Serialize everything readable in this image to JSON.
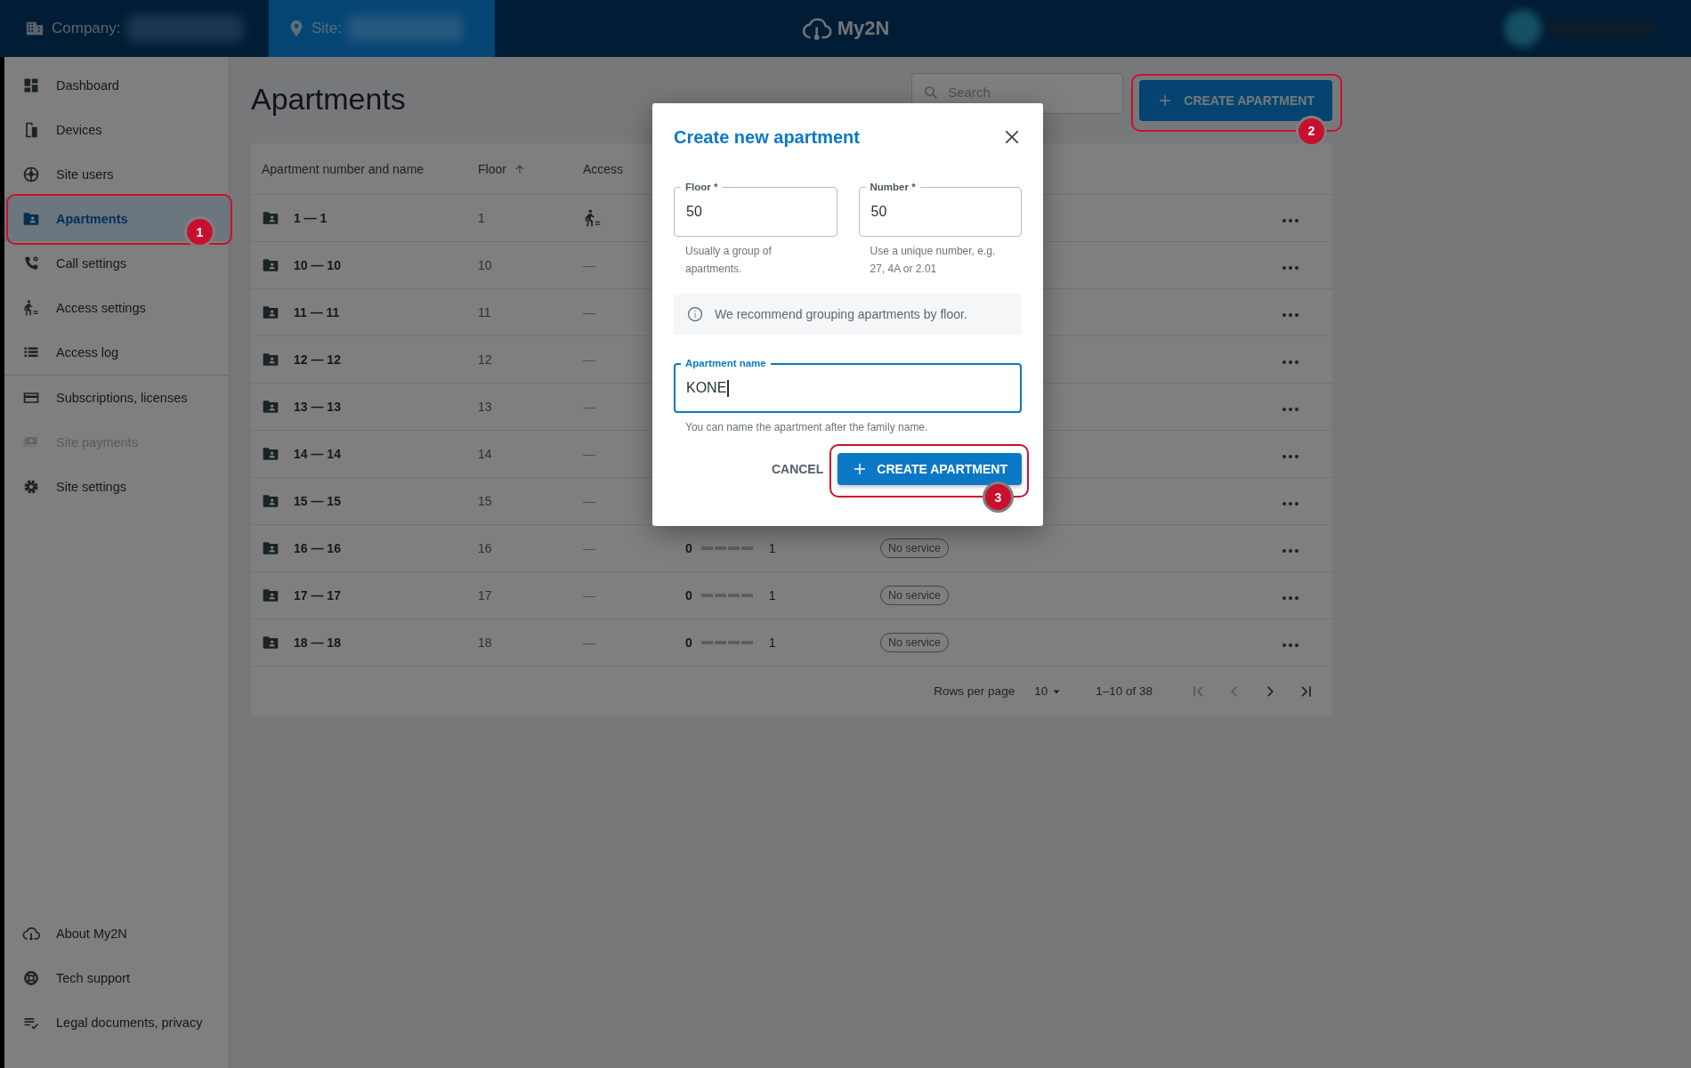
{
  "topbar": {
    "company_label": "Company:",
    "site_label": "Site:",
    "logo_text": "My2N"
  },
  "sidebar": {
    "sections": [
      {
        "items": [
          {
            "label": "Dashboard",
            "selected": false,
            "disabled": false
          },
          {
            "label": "Devices",
            "selected": false,
            "disabled": false
          },
          {
            "label": "Site users",
            "selected": false,
            "disabled": false
          },
          {
            "label": "Apartments",
            "selected": true,
            "disabled": false,
            "callout": "1"
          },
          {
            "label": "Call settings",
            "selected": false,
            "disabled": false
          },
          {
            "label": "Access settings",
            "selected": false,
            "disabled": false
          },
          {
            "label": "Access log",
            "selected": false,
            "disabled": false
          }
        ]
      },
      {
        "items": [
          {
            "label": "Subscriptions, licenses",
            "selected": false,
            "disabled": false
          },
          {
            "label": "Site payments",
            "selected": false,
            "disabled": true
          },
          {
            "label": "Site settings",
            "selected": false,
            "disabled": false
          }
        ]
      }
    ],
    "footer": [
      {
        "label": "About My2N",
        "selected": false,
        "disabled": false
      },
      {
        "label": "Tech support",
        "selected": false,
        "disabled": false
      },
      {
        "label": "Legal documents, privacy",
        "selected": false,
        "disabled": false
      }
    ]
  },
  "page": {
    "title": "Apartments",
    "search": {
      "placeholder": "Search"
    },
    "create_button": {
      "label": "CREATE APARTMENT",
      "callout": "2"
    }
  },
  "table": {
    "columns": [
      {
        "label": "Apartment number and name",
        "sorted": false
      },
      {
        "label": "Floor",
        "sorted": true
      },
      {
        "label": "Access",
        "sorted": false
      }
    ],
    "rows": [
      {
        "name": "1 — 1",
        "floor": "1",
        "access": {
          "kind": "icon"
        }
      },
      {
        "name": "10 — 10",
        "floor": "10",
        "access": {
          "kind": "text",
          "text": "—"
        }
      },
      {
        "name": "11 — 11",
        "floor": "11",
        "access": {
          "kind": "text",
          "text": "—"
        }
      },
      {
        "name": "12 — 12",
        "floor": "12",
        "access": {
          "kind": "text",
          "text": "—"
        }
      },
      {
        "name": "13 — 13",
        "floor": "13",
        "access": {
          "kind": "text",
          "text": "—"
        }
      },
      {
        "name": "14 — 14",
        "floor": "14",
        "access": {
          "kind": "text",
          "text": "—"
        }
      },
      {
        "name": "15 — 15",
        "floor": "15",
        "access": {
          "kind": "text",
          "text": "—"
        }
      },
      {
        "name": "16 — 16",
        "floor": "16",
        "access": {
          "kind": "text",
          "text": "—"
        },
        "column_4": {
          "from": "0",
          "to": "1"
        },
        "column_5": "No service"
      },
      {
        "name": "17 — 17",
        "floor": "17",
        "access": {
          "kind": "text",
          "text": "—"
        },
        "column_4": {
          "from": "0",
          "to": "1"
        },
        "column_5": "No service"
      },
      {
        "name": "18 — 18",
        "floor": "18",
        "access": {
          "kind": "text",
          "text": "—"
        },
        "column_4": {
          "from": "0",
          "to": "1"
        },
        "column_5": "No service"
      }
    ],
    "pagination": {
      "rows_per_page_label": "Rows per page",
      "rows_per_page": "10",
      "range": "1–10 of 38"
    }
  },
  "dialog": {
    "title": "Create new apartment",
    "fields": [
      {
        "label": "Floor *",
        "value": "50",
        "helper": "Usually a group of apartments.",
        "focused": false
      },
      {
        "label": "Number *",
        "value": "50",
        "helper": "Use a unique number, e.g. 27, 4A or 2.01",
        "focused": false
      }
    ],
    "info": "We recommend grouping apartments by floor.",
    "name_field": {
      "label": "Apartment name",
      "value": "KONE",
      "helper": "You can name the apartment after the family name.",
      "focused": true
    },
    "cancel_label": "CANCEL",
    "submit": {
      "label": "CREATE APARTMENT",
      "callout": "3"
    }
  }
}
